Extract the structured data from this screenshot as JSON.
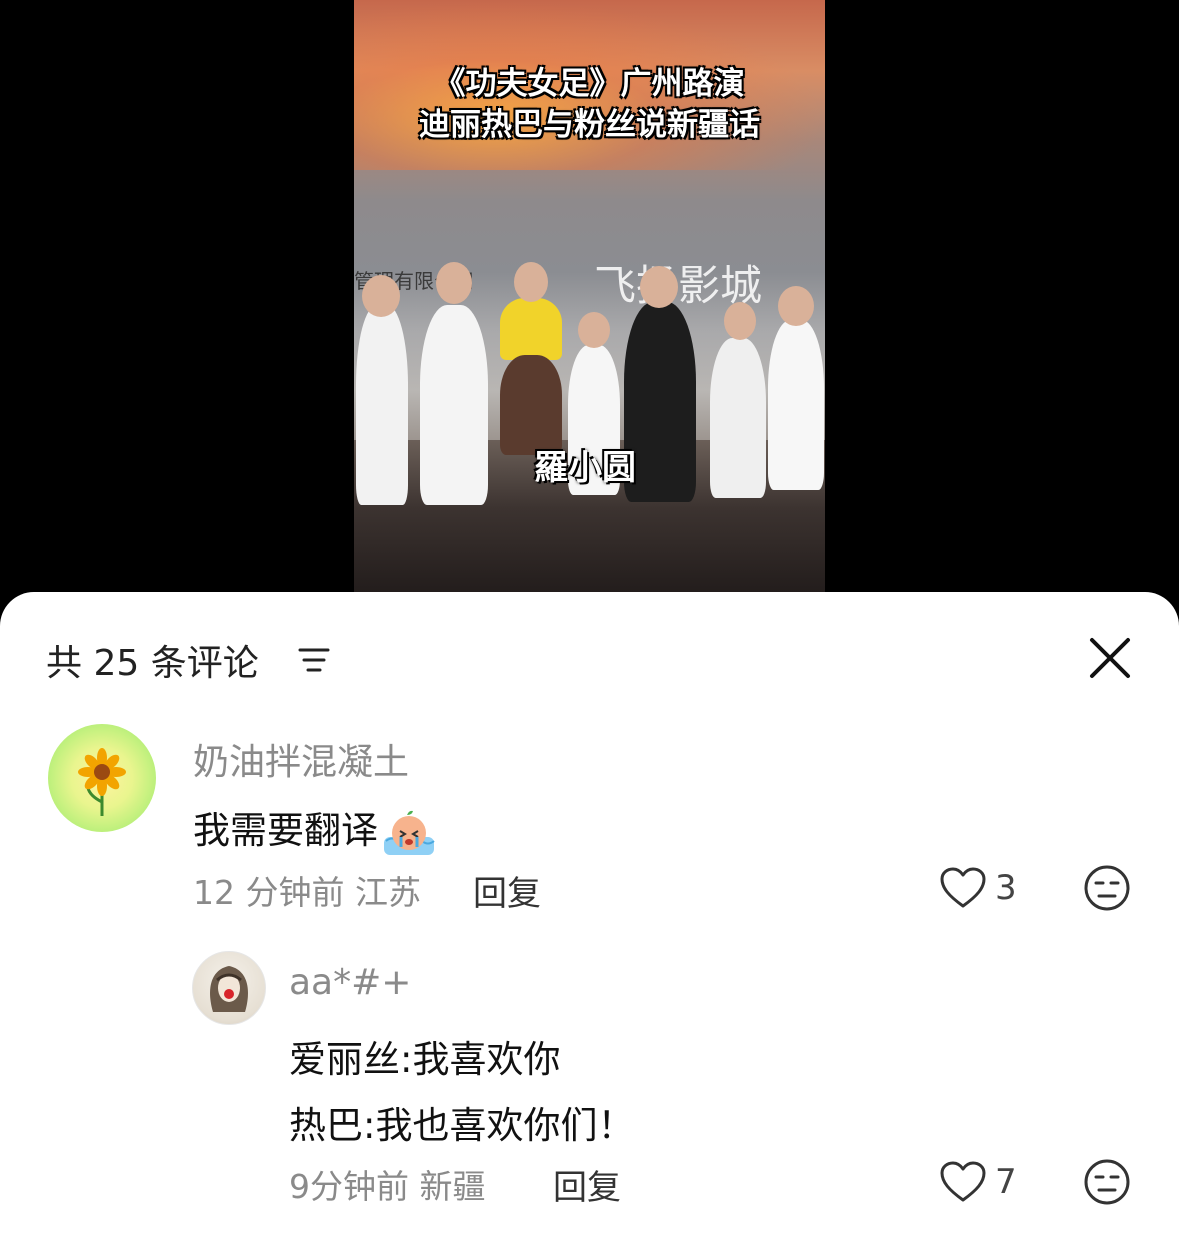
{
  "video": {
    "caption_line1": "《功夫女足》广州路演",
    "caption_line2": "迪丽热巴与粉丝说新疆话",
    "backdrop_text": "管理有限公司",
    "backdrop_logo": "飞扬影城",
    "name_label": "羅小圆"
  },
  "comments_header": {
    "count_label": "共 25 条评论",
    "sort_icon": "sort-lines-icon",
    "close_icon": "close-icon"
  },
  "comments": [
    {
      "username": "奶油拌混凝土",
      "text": "我需要翻译",
      "emoji": "crying-emoji",
      "meta": "12 分钟前 江苏",
      "reply_label": "回复",
      "likes": "3"
    },
    {
      "username": "aa*#+",
      "text_line1": "爱丽丝:我喜欢你",
      "text_line2": "热巴:我也喜欢你们！",
      "meta": "9分钟前 新疆",
      "reply_label": "回复",
      "likes": "7"
    }
  ],
  "colors": {
    "sheet_bg": "#ffffff",
    "muted_text": "#8a8a8a",
    "primary_text": "#111111"
  }
}
